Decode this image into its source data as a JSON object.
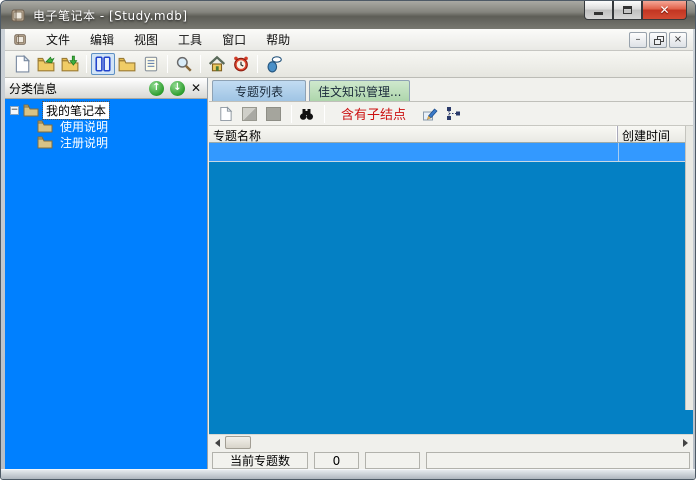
{
  "window": {
    "title": "电子笔记本 - [Study.mdb]",
    "controls": [
      "minimize",
      "maximize",
      "close"
    ]
  },
  "menu_bar": {
    "items": [
      {
        "label": "文件"
      },
      {
        "label": "编辑"
      },
      {
        "label": "视图"
      },
      {
        "label": "工具"
      },
      {
        "label": "窗口"
      },
      {
        "label": "帮助"
      }
    ],
    "mdi_controls": [
      "minimize",
      "restore",
      "close"
    ]
  },
  "toolbar": {
    "icons": [
      "new-document",
      "open-file",
      "import-folder",
      "view-panels",
      "open-folder",
      "notes-list",
      "search",
      "home",
      "alarm-clock",
      "key"
    ]
  },
  "sidebar": {
    "header_title": "分类信息",
    "header_buttons": [
      "move-up",
      "move-down",
      "close"
    ],
    "tree": {
      "root": "我的笔记本",
      "root_selected": true,
      "children": [
        "使用说明",
        "注册说明"
      ]
    }
  },
  "main": {
    "tabs": [
      {
        "label": "专题列表",
        "active": true
      },
      {
        "label": "佳文知识管理...",
        "active": false
      }
    ],
    "toolbar": {
      "icons": [
        "new-page",
        "disabled-tool",
        "disabled-block",
        "binoculars-search",
        "edit-pencil",
        "tree-nodes"
      ],
      "filter_label": "含有子结点"
    },
    "table": {
      "columns": [
        {
          "label": "专题名称"
        },
        {
          "label": "创建时间"
        }
      ],
      "rows": []
    },
    "status_bar": {
      "cells": [
        "当前专题数",
        "0",
        "",
        ""
      ]
    }
  },
  "colors": {
    "sidebar_bg": "#0080ff",
    "list_bg": "#0480c4",
    "selected_row_bg": "#3399ff",
    "tab_active_bg": "#aecfe8",
    "tab_inactive_bg": "#b9d8b9",
    "filter_text": "#cc1111",
    "titlebar_close": "#c23522"
  }
}
